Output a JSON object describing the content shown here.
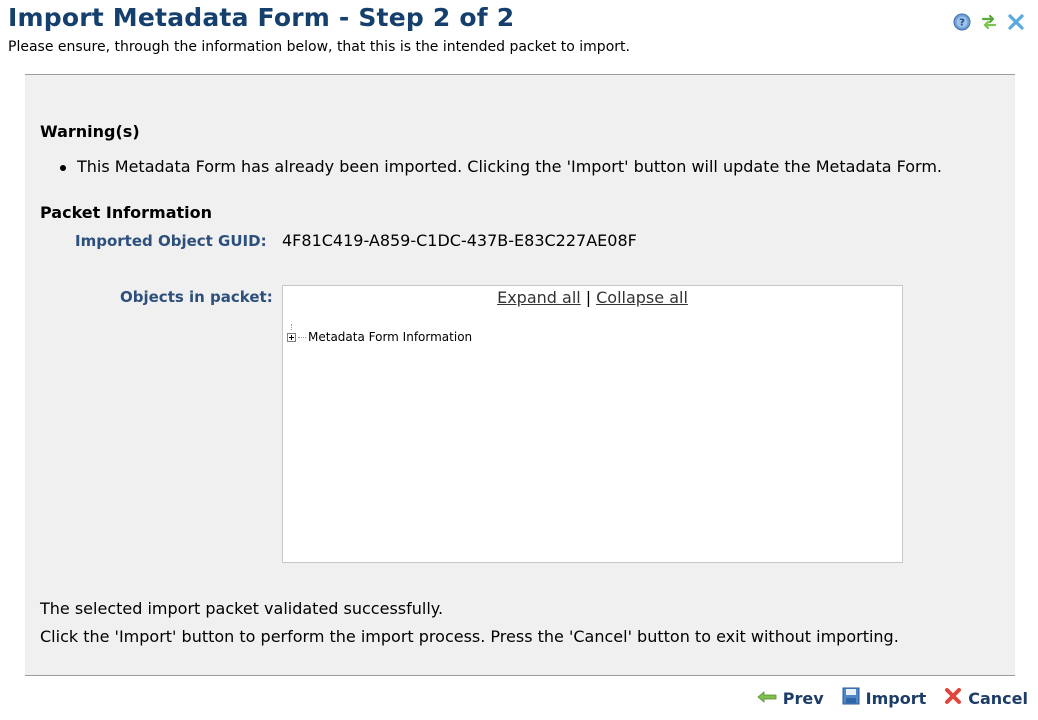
{
  "header": {
    "title": "Import Metadata Form - Step 2 of 2",
    "subtitle": "Please ensure, through the information below, that this is the intended packet to import.",
    "icons": [
      "help-icon",
      "refresh-icon",
      "close-icon"
    ]
  },
  "warnings": {
    "heading": "Warning(s)",
    "items": [
      "This Metadata Form has already been imported. Clicking the 'Import' button will update the Metadata Form."
    ]
  },
  "packet": {
    "heading": "Packet Information",
    "guid_label": "Imported Object GUID:",
    "guid_value": "4F81C419-A859-C1DC-437B-E83C227AE08F",
    "objects_label": "Objects in packet:",
    "expand_all": "Expand all",
    "separator": "|",
    "collapse_all": "Collapse all",
    "tree_items": [
      "Metadata Form Information"
    ]
  },
  "messages": {
    "validated": "The selected import packet validated successfully.",
    "instruction": "Click the 'Import' button to perform the import process. Press the 'Cancel' button to exit without importing."
  },
  "footer": {
    "prev": "Prev",
    "import": "Import",
    "cancel": "Cancel"
  },
  "colors": {
    "title": "#153f6c",
    "label": "#2d4f7b",
    "panel_bg": "#f0f0f0"
  }
}
